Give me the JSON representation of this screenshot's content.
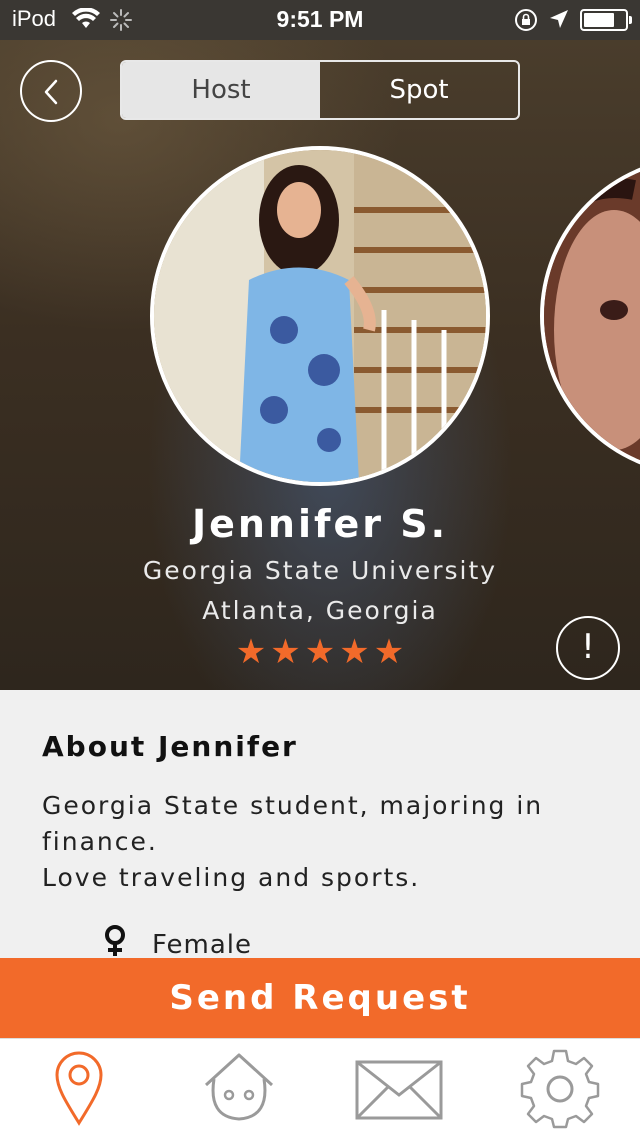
{
  "status_bar": {
    "carrier": "iPod",
    "time": "9:51 PM"
  },
  "header": {
    "segments": [
      "Host",
      "Spot"
    ],
    "active_segment": "Host"
  },
  "profile": {
    "name": "Jennifer S.",
    "school": "Georgia State University",
    "location": "Atlanta, Georgia",
    "rating": 5
  },
  "about": {
    "title": "About Jennifer",
    "body_line1": "Georgia State student, majoring in finance.",
    "body_line2": "Love traveling and sports.",
    "gender": "Female"
  },
  "actions": {
    "send_request": "Send Request"
  },
  "tabbar": {
    "items": [
      "map-pin-icon",
      "house-face-icon",
      "envelope-icon",
      "gear-icon"
    ]
  },
  "colors": {
    "accent": "#f26a2a",
    "inactive_icon": "#9a9a9a"
  }
}
